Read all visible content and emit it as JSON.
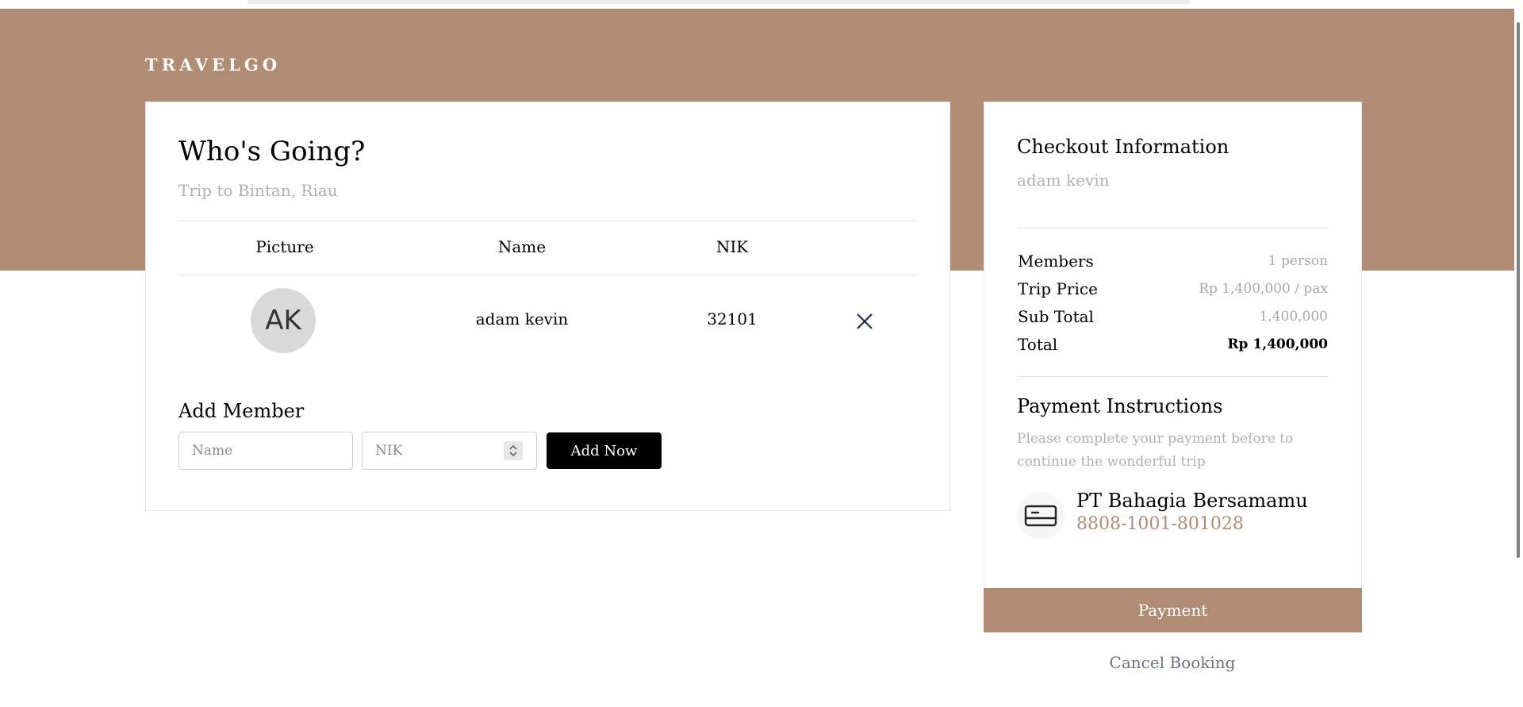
{
  "brand": "TRAVELGO",
  "colors": {
    "accent": "#b08c74",
    "button_dark": "#000000",
    "muted_text": "#b0b0b0"
  },
  "members_section": {
    "title": "Who's Going?",
    "subtitle": "Trip to Bintan, Riau",
    "columns": [
      "Picture",
      "Name",
      "NIK"
    ],
    "rows": [
      {
        "initials": "AK",
        "name": "adam kevin",
        "nik": "32101",
        "action_icon": "close-icon"
      }
    ]
  },
  "add_member": {
    "title": "Add Member",
    "name_placeholder": "Name",
    "nik_placeholder": "NIK",
    "button_label": "Add Now"
  },
  "checkout": {
    "title": "Checkout Information",
    "user": "adam kevin",
    "rows": [
      {
        "label": "Members",
        "value": "1 person"
      },
      {
        "label": "Trip Price",
        "value": "Rp 1,400,000 / pax"
      },
      {
        "label": "Sub Total",
        "value": "1,400,000"
      },
      {
        "label": "Total",
        "value": "Rp 1,400,000"
      }
    ]
  },
  "payment": {
    "title": "Payment Instructions",
    "note": "Please complete your payment before to continue the wonderful trip",
    "bank_icon": "credit-card-icon",
    "bank_name": "PT Bahagia Bersamamu",
    "account_number": "8808-1001-801028",
    "pay_button": "Payment",
    "cancel_label": "Cancel Booking"
  }
}
